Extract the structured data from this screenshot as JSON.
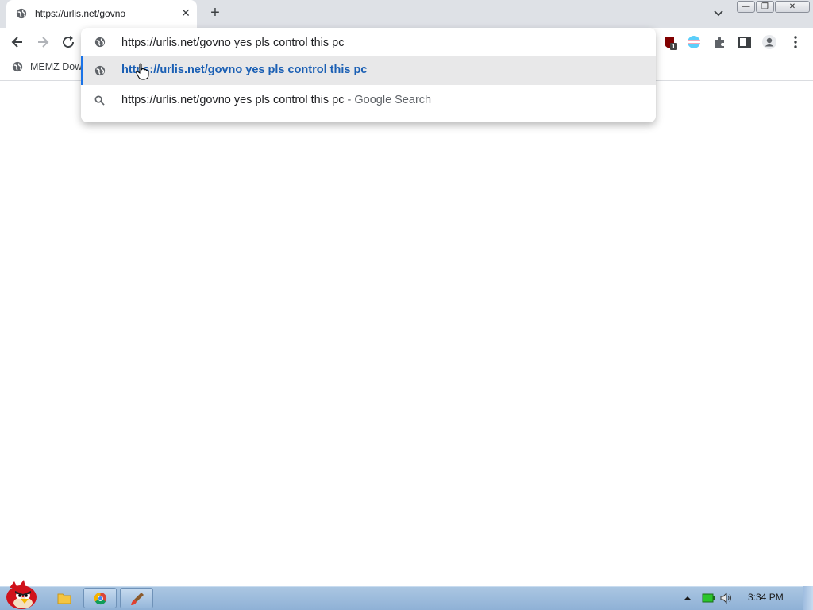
{
  "tab": {
    "title": "https://urlis.net/govno",
    "favicon": "globe-icon",
    "close_label": "✕"
  },
  "tabstrip": {
    "new_tab_label": "+"
  },
  "window_controls": {
    "minimize": "—",
    "maximize": "❐",
    "close": "✕"
  },
  "omnibox": {
    "input_value": "https://urlis.net/govno yes pls control this pc",
    "suggestions": [
      {
        "icon": "globe-icon",
        "text": "https://urlis.net/govno yes pls control this pc",
        "selected": true
      },
      {
        "icon": "search-icon",
        "text": "https://urlis.net/govno yes pls control this pc",
        "suffix": "- Google Search",
        "selected": false
      }
    ]
  },
  "bookmarks": {
    "items": [
      {
        "icon": "globe-icon",
        "label": "MEMZ Dow"
      }
    ]
  },
  "extensions": {
    "ublock_badge": "1"
  },
  "taskbar": {
    "clock": "3:34 PM"
  },
  "colors": {
    "accent": "#1a73e8",
    "tabstrip": "#dee1e6",
    "taskbar": "#9fbde0",
    "suggestion_link": "#1a5fb4"
  }
}
